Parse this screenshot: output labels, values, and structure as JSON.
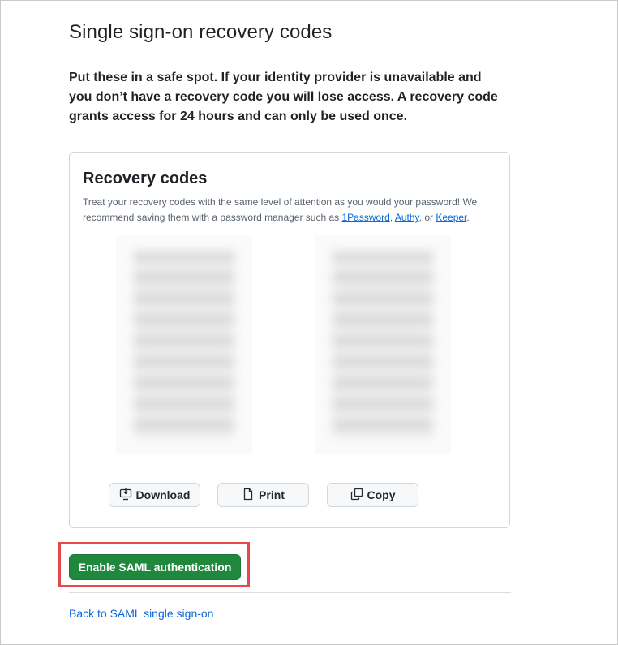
{
  "page": {
    "title": "Single sign-on recovery codes",
    "intro": "Put these in a safe spot. If your identity provider is unavailable and you don’t have a recovery code you will lose access. A recovery code grants access for 24 hours and can only be used once."
  },
  "card": {
    "title": "Recovery codes",
    "desc_before": "Treat your recovery codes with the same level of attention as you would your password! We recommend saving them with a password manager such as ",
    "link_1password": "1Password",
    "sep1": ", ",
    "link_authy": "Authy",
    "sep2": ", or ",
    "link_keeper": "Keeper",
    "desc_after": "."
  },
  "actions": {
    "download": "Download",
    "print": "Print",
    "copy": "Copy"
  },
  "enable_button": "Enable SAML authentication",
  "back_link": "Back to SAML single sign-on",
  "icons": {
    "download": "download-icon",
    "print": "file-icon",
    "copy": "copy-icon"
  },
  "colors": {
    "primary": "#1f883d",
    "link": "#0969da",
    "highlight": "#e5484d"
  }
}
